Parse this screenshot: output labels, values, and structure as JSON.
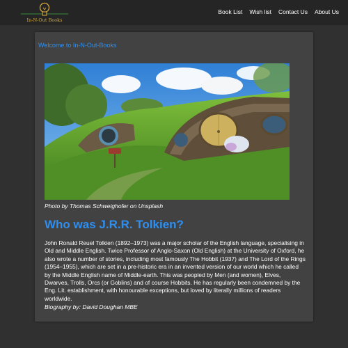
{
  "navbar": {
    "brand_text": "In-N-Out Books",
    "links": [
      "Book List",
      "Wish list",
      "Contact Us",
      "About Us"
    ]
  },
  "main": {
    "welcome": "Welcome to In-N-Out-Books",
    "photo_caption": "Photo by Thomas Schweighofer on Unsplash",
    "heading": "Who was J.R.R. Tolkien?",
    "bio": "John Ronald Reuel Tolkien (1892–1973) was a major scholar of the English language, specialising in Old and Middle English. Twice Professor of Anglo-Saxon (Old English) at the University of Oxford, he also wrote a number of stories, including most famously The Hobbit (1937) and The Lord of the Rings (1954–1955), which are set in a pre-historic era in an invented version of our world which he called by the Middle English name of Middle-earth. This was peopled by Men (and women), Elves, Dwarves, Trolls, Orcs (or Goblins) and of course Hobbits. He has regularly been condemned by the Eng. Lit. establishment, with honourable exceptions, but loved by literally millions of readers worldwide.",
    "byline": "Biography by: David Doughan MBE"
  },
  "colors": {
    "page_background": "#303030",
    "navbar_background": "#252525",
    "card_background": "#424242",
    "accent": "#2e8ff0",
    "brand": "#d4a93a"
  }
}
